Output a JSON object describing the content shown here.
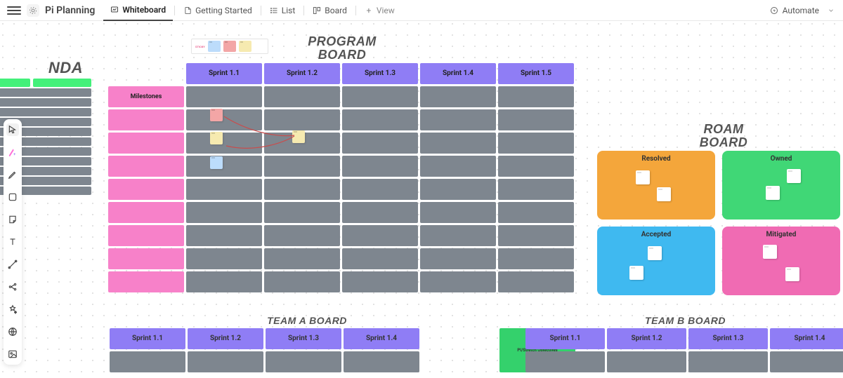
{
  "doc": {
    "title": "Pi Planning"
  },
  "tabs": {
    "whiteboard": "Whiteboard",
    "getting_started": "Getting Started",
    "list": "List",
    "board": "Board",
    "view": "View"
  },
  "top_right": {
    "automate": "Automate"
  },
  "agenda": {
    "title": "NDA",
    "rows": [
      {
        "a": "",
        "b": ""
      },
      {
        "b": ""
      },
      {
        "b": ""
      },
      {
        "b": ""
      },
      {
        "b": ""
      },
      {
        "b": ""
      },
      {
        "b": ""
      },
      {
        "b": ""
      },
      {
        "b": ""
      },
      {
        "b": ""
      },
      {
        "b": ""
      }
    ]
  },
  "legend": {
    "label": "STICKY"
  },
  "program": {
    "title_l1": "PROGRAM",
    "title_l2": "BOARD",
    "sprints": [
      "Sprint 1.1",
      "Sprint 1.2",
      "Sprint 1.3",
      "Sprint 1.4",
      "Sprint 1.5"
    ],
    "rows": [
      "Milestones",
      "",
      "",
      "",
      "",
      "",
      "",
      "",
      ""
    ],
    "row_labels_small": [
      "",
      "",
      "",
      "",
      "",
      "",
      "",
      "",
      ""
    ]
  },
  "roam": {
    "title_l1": "ROAM",
    "title_l2": "BOARD",
    "cells": {
      "resolved": "Resolved",
      "owned": "Owned",
      "accepted": "Accepted",
      "mitigated": "Mitigated"
    }
  },
  "teamA": {
    "title": "TEAM A BOARD",
    "sprints": [
      "Sprint 1.1",
      "Sprint 1.2",
      "Sprint 1.3",
      "Sprint 1.4"
    ],
    "objectives": "PI/Stretch Objectives"
  },
  "teamB": {
    "title": "TEAM B BOARD",
    "sprints": [
      "Sprint 1.1",
      "Sprint 1.2",
      "Sprint 1.3",
      "Sprint 1.4"
    ]
  }
}
